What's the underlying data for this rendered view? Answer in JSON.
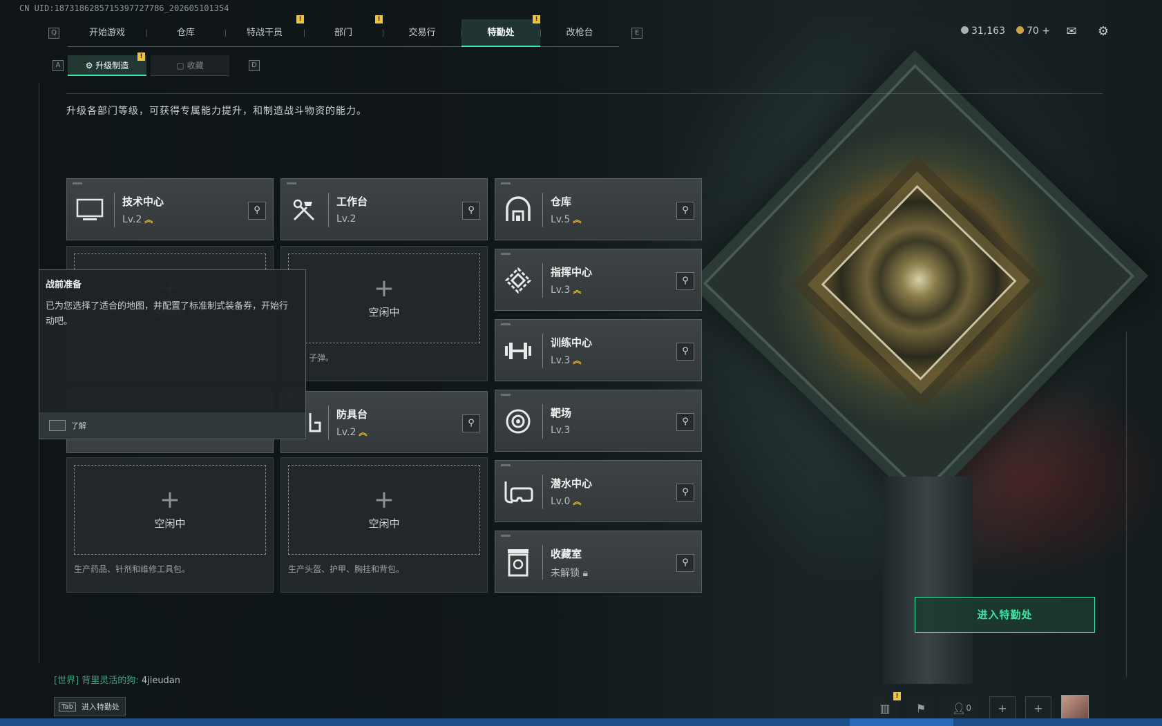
{
  "uid": "CN UID:1873186285715397727786_202605101354",
  "nav": {
    "left_key": "Q",
    "right_key": "E",
    "tabs": [
      {
        "label": "开始游戏",
        "alert": false,
        "active": false
      },
      {
        "label": "仓库",
        "alert": false,
        "active": false
      },
      {
        "label": "特战干员",
        "alert": true,
        "active": false
      },
      {
        "label": "部门",
        "alert": true,
        "active": false
      },
      {
        "label": "交易行",
        "alert": false,
        "active": false
      },
      {
        "label": "特勤处",
        "alert": true,
        "active": true
      },
      {
        "label": "改枪台",
        "alert": false,
        "active": false
      }
    ]
  },
  "currency": {
    "silver": "31,163",
    "gold": "70",
    "add_label": "+"
  },
  "subnav": {
    "left_key": "A",
    "right_key": "D",
    "tabs": [
      {
        "label": "升级制造",
        "active": true,
        "alert": true
      },
      {
        "label": "收藏",
        "active": false,
        "alert": false
      }
    ]
  },
  "alert_mark": "!",
  "description": "升级各部门等级，可获得专属能力提升，和制造战斗物资的能力。",
  "facilities": [
    {
      "name": "技术中心",
      "level": "Lv.2",
      "upgradable": true,
      "icon": "monitor-icon"
    },
    {
      "name": "工作台",
      "level": "Lv.2",
      "upgradable": false,
      "icon": "tools-icon"
    },
    {
      "name": "仓库",
      "level": "Lv.5",
      "upgradable": true,
      "icon": "warehouse-icon"
    },
    {
      "name": "指挥中心",
      "level": "Lv.3",
      "upgradable": true,
      "icon": "command-icon"
    },
    {
      "name": "训练中心",
      "level": "Lv.3",
      "upgradable": true,
      "icon": "dumbbell-icon"
    },
    {
      "name": "防具台",
      "level": "Lv.2",
      "upgradable": true,
      "icon": "armor-icon"
    },
    {
      "name": "靶场",
      "level": "Lv.3",
      "upgradable": false,
      "icon": "target-icon"
    },
    {
      "name": "潜水中心",
      "level": "Lv.0",
      "upgradable": true,
      "icon": "diving-icon"
    },
    {
      "name": "收藏室",
      "level": "未解锁",
      "upgradable": false,
      "locked": true,
      "icon": "collection-icon"
    }
  ],
  "slots": {
    "idle_label": "空闲中",
    "plus": "+",
    "workbench_desc": "子弹。",
    "tech_desc": "生产药品、针剂和维修工具包。",
    "armor_desc": "生产头盔、护甲、胸挂和背包。"
  },
  "tooltip": {
    "title": "战前准备",
    "body": "已为您选择了适合的地图，并配置了标准制式装备券，开始行动吧。",
    "action": "了解"
  },
  "enter_button": "进入特勤处",
  "chat": {
    "channel": "[世界]",
    "sender": "背里灵活的狗:",
    "message": "4jieudan"
  },
  "tab_hint": {
    "key": "Tab",
    "label": "进入特勤处"
  },
  "bottom": {
    "friend_count": "0"
  },
  "colors": {
    "accent": "#3be6a6",
    "upgrade": "#e5b53a",
    "alert": "#f0c43a"
  }
}
